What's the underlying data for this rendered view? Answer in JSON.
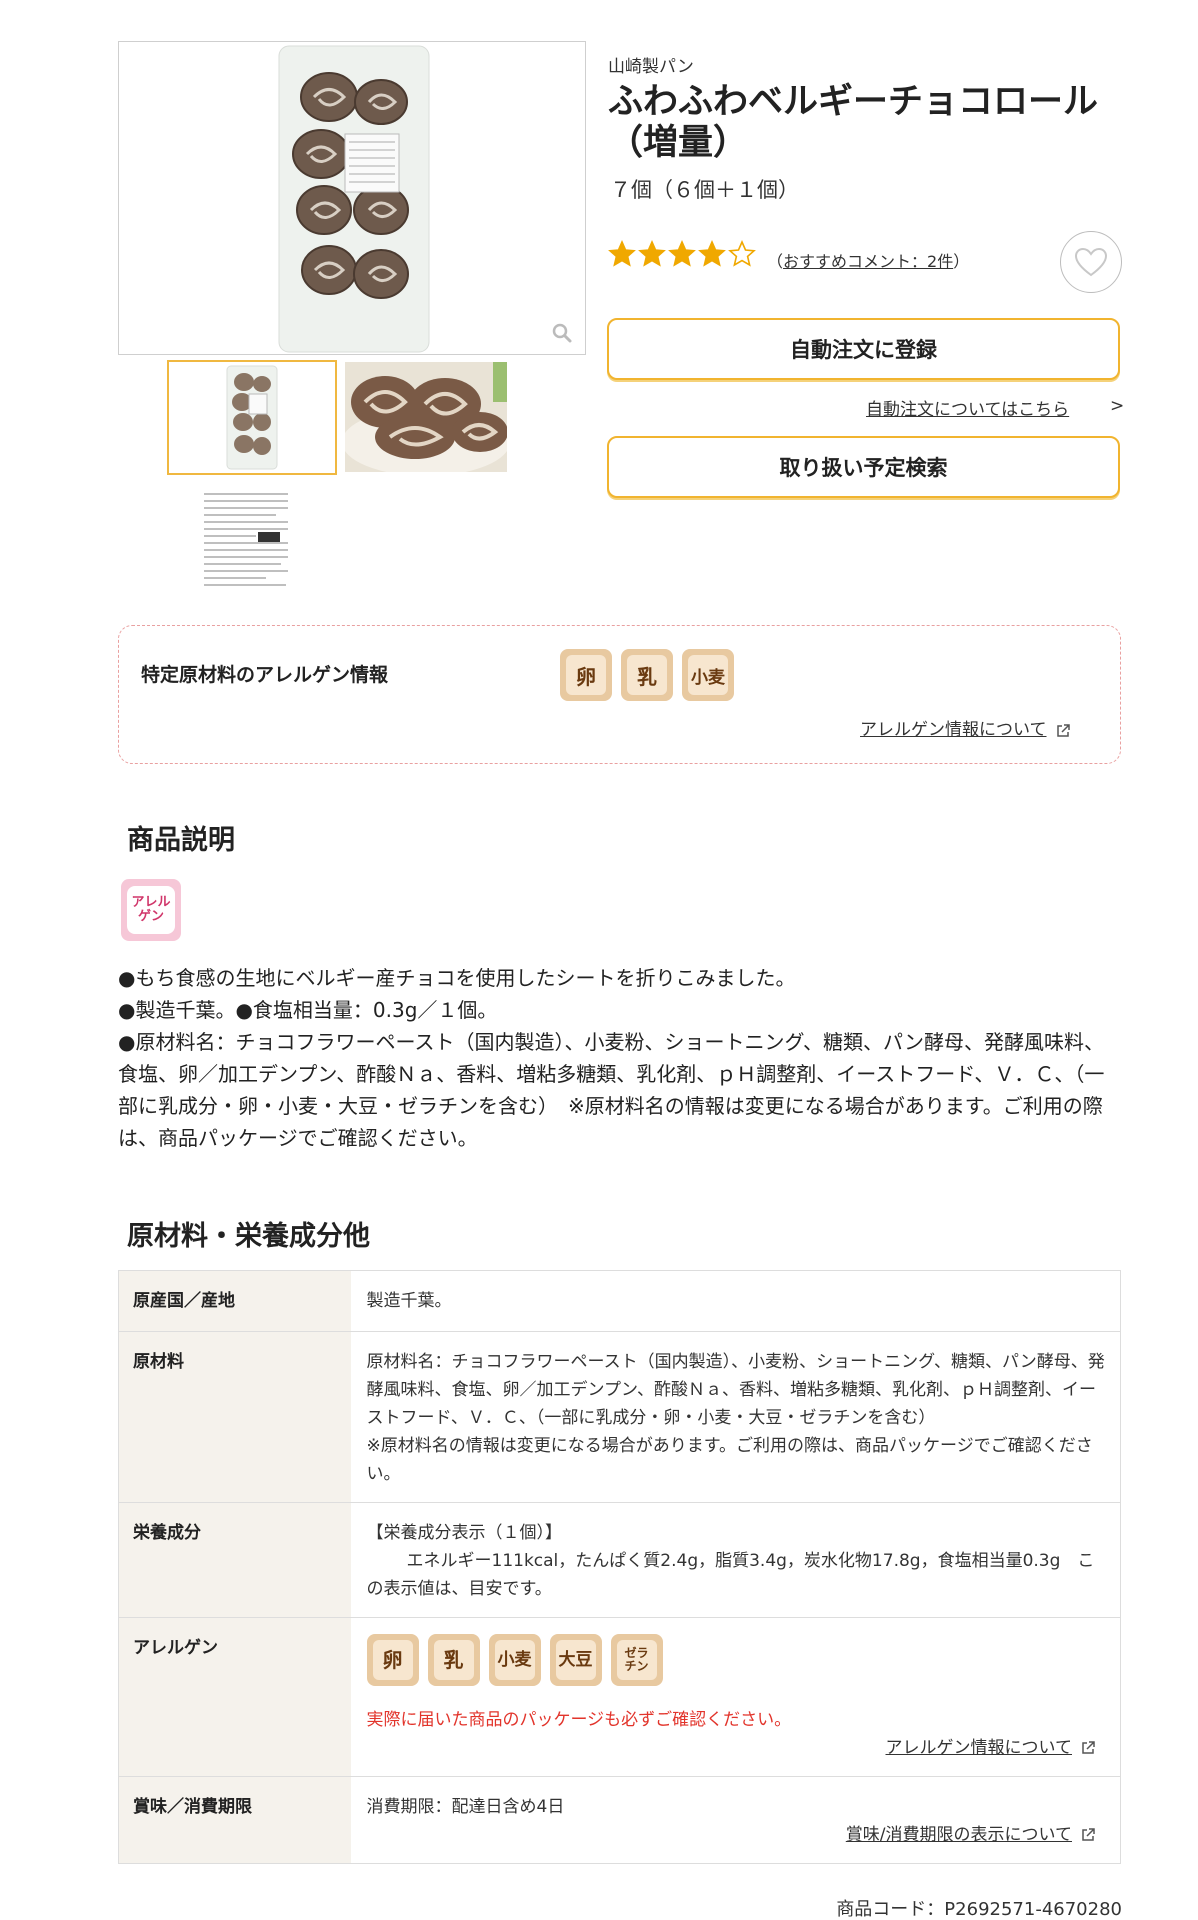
{
  "product": {
    "brand": "山崎製パン",
    "title_line1": "ふわふわベルギーチョコロール",
    "title_line2": "（増量）",
    "quantity": "７個（６個＋１個）",
    "rating": 4,
    "rating_max": 5,
    "review_link": "おすすめコメント：2件",
    "review_prefix": "（",
    "review_suffix": "）"
  },
  "gallery": {
    "zoom_icon": "search-icon"
  },
  "actions": {
    "auto_order_label": "自動注文に登録",
    "auto_order_info_link": "自動注文についてはこちら",
    "auto_order_info_arrow": ">",
    "schedule_search_label": "取り扱い予定検索",
    "favorite_icon": "heart-icon"
  },
  "allergen_box": {
    "label": "特定原材料のアレルゲン情報",
    "chips": [
      "卵",
      "乳",
      "小麦"
    ],
    "link": "アレルゲン情報について"
  },
  "description": {
    "title": "商品説明",
    "badge": "アレル\nゲン",
    "lines": [
      "●もち食感の生地にベルギー産チョコを使用したシートを折りこみました。",
      "●製造千葉。●食塩相当量：0.3g／１個。",
      "●原材料名：チョコフラワーペースト（国内製造）、小麦粉、ショートニング、糖類、パン酵母、発酵風味料、食塩、卵／加工デンプン、酢酸Ｎａ、香料、増粘多糖類、乳化剤、ｐＨ調整剤、イーストフード、Ｖ．Ｃ、（一部に乳成分・卵・小麦・大豆・ゼラチンを含む）　※原材料名の情報は変更になる場合があります。ご利用の際は、商品パッケージでご確認ください。"
    ]
  },
  "specs": {
    "title": "原材料・栄養成分他",
    "origin_label": "原産国／産地",
    "origin_value": "製造千葉。",
    "ingredients_label": "原材料",
    "ingredients_value": "原材料名：チョコフラワーペースト（国内製造）、小麦粉、ショートニング、糖類、パン酵母、発酵風味料、食塩、卵／加工デンプン、酢酸Ｎａ、香料、増粘多糖類、乳化剤、ｐＨ調整剤、イーストフード、Ｖ．Ｃ、（一部に乳成分・卵・小麦・大豆・ゼラチンを含む）",
    "ingredients_note": "※原材料名の情報は変更になる場合があります。ご利用の際は、商品パッケージでご確認ください。",
    "nutrition_label": "栄養成分",
    "nutrition_heading": "【栄養成分表示（１個）】",
    "nutrition_value": "エネルギー111kcal，たんぱく質2.4g，脂質3.4g，炭水化物17.8g，食塩相当量0.3g　この表示値は、目安です。",
    "allergen_label": "アレルゲン",
    "allergen_chips": [
      "卵",
      "乳",
      "小麦",
      "大豆"
    ],
    "allergen_chip_gelatin": "ゼラ\nチン",
    "allergen_warning": "実際に届いた商品のパッケージも必ずご確認ください。",
    "allergen_link": "アレルゲン情報について",
    "expiry_label": "賞味／消費期限",
    "expiry_value": "消費期限：配達日含め4日",
    "expiry_link": "賞味/消費期限の表示について"
  },
  "product_code": "商品コード：P2692571-4670280",
  "colors": {
    "accent": "#f1b42f",
    "star": "#f0a800",
    "dashed_border": "#e9a0a0",
    "warning_red": "#e2342b",
    "chip": "#e8c9a0"
  }
}
